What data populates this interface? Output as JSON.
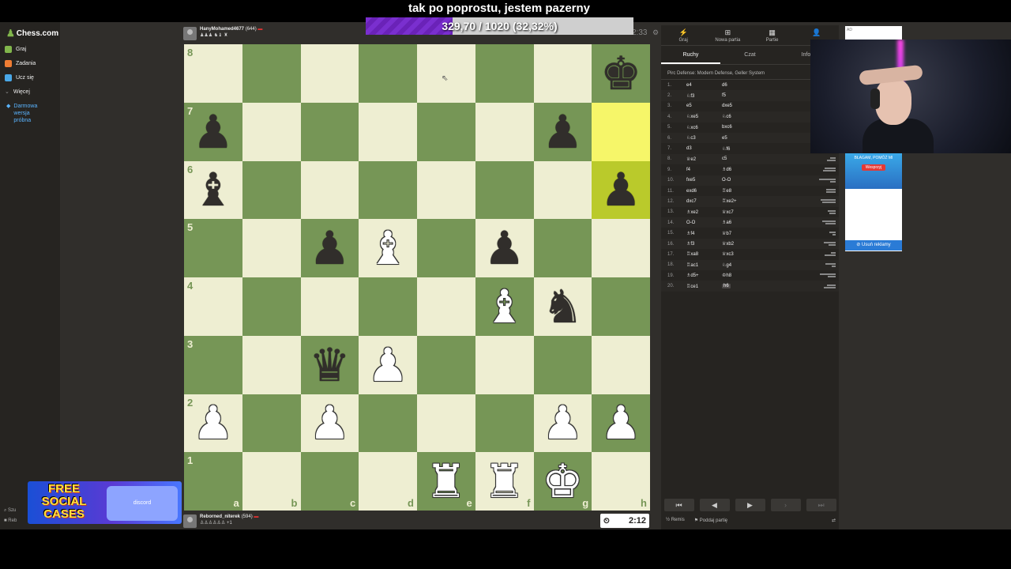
{
  "overlay": {
    "title": "tak po poprostu, jestem pazerny",
    "goal_text": "329,70 / 1020 (32,32%)",
    "goal_fraction": 0.3232
  },
  "sidebar": {
    "logo": "Chess.com",
    "items": [
      {
        "label": "Graj",
        "icon": "play-icon",
        "color": "#81b64c"
      },
      {
        "label": "Zadania",
        "icon": "puzzle-icon",
        "color": "#f07d33"
      },
      {
        "label": "Ucz się",
        "icon": "learn-icon",
        "color": "#4aa8e8"
      },
      {
        "label": "Więcej",
        "icon": "chevron-down-icon",
        "color": "#999"
      }
    ],
    "promo": "Darmowa wersja próbna",
    "bottom": [
      "Szu",
      "Reb"
    ]
  },
  "ad_overlay": {
    "text": "FREE SOCIAL CASES",
    "brand": "discord"
  },
  "players": {
    "top": {
      "name": "HanyMohamed4677",
      "rating": "(644)",
      "time": "2:33"
    },
    "bottom": {
      "name": "Reborned_niterek",
      "rating": "(594)",
      "time": "2:12"
    }
  },
  "board": {
    "files": [
      "a",
      "b",
      "c",
      "d",
      "e",
      "f",
      "g",
      "h"
    ],
    "ranks": [
      "8",
      "7",
      "6",
      "5",
      "4",
      "3",
      "2",
      "1"
    ],
    "highlight": [
      "h7",
      "h6"
    ],
    "pieces": {
      "h8": "bK",
      "a7": "bP",
      "g7": "bP",
      "a6": "bB",
      "h6": "bP",
      "c5": "bP",
      "d5": "wB",
      "f5": "bP",
      "f4": "wB",
      "g4": "bN",
      "c3": "bQ",
      "d3": "wP",
      "a2": "wP",
      "c2": "wP",
      "g2": "wP",
      "h2": "wP",
      "e1": "wR",
      "f1": "wR",
      "g1": "wK"
    }
  },
  "right_panel": {
    "top_tabs": [
      {
        "label": "Graj",
        "icon": "lightning-icon"
      },
      {
        "label": "Nowa partia",
        "icon": "plus-icon"
      },
      {
        "label": "Partie",
        "icon": "grid-icon"
      },
      {
        "label": "",
        "icon": "people-icon"
      }
    ],
    "tabs": [
      "Ruchy",
      "Czat",
      "Inform"
    ],
    "opening": "Pirc Defense: Modern Defense, Geller System",
    "moves": [
      {
        "n": "1.",
        "w": "e4",
        "b": "d6"
      },
      {
        "n": "2.",
        "w": "♘f3",
        "b": "f5"
      },
      {
        "n": "3.",
        "w": "e5",
        "b": "dxe5"
      },
      {
        "n": "4.",
        "w": "♘xe5",
        "b": "♘c6"
      },
      {
        "n": "5.",
        "w": "♘xc6",
        "b": "bxc6"
      },
      {
        "n": "6.",
        "w": "♘c3",
        "b": "e5"
      },
      {
        "n": "7.",
        "w": "d3",
        "b": "♘f6"
      },
      {
        "n": "8.",
        "w": "♕e2",
        "b": "c5"
      },
      {
        "n": "9.",
        "w": "f4",
        "b": "♗d6"
      },
      {
        "n": "10.",
        "w": "fxe5",
        "b": "O-O"
      },
      {
        "n": "11.",
        "w": "exd6",
        "b": "♖e8"
      },
      {
        "n": "12.",
        "w": "dxc7",
        "b": "♖xe2+"
      },
      {
        "n": "13.",
        "w": "♗xe2",
        "b": "♕xc7"
      },
      {
        "n": "14.",
        "w": "O-O",
        "b": "♗a6"
      },
      {
        "n": "15.",
        "w": "♗f4",
        "b": "♕b7"
      },
      {
        "n": "16.",
        "w": "♗f3",
        "b": "♕xb2"
      },
      {
        "n": "17.",
        "w": "♖xa8",
        "b": "♕xc3"
      },
      {
        "n": "18.",
        "w": "♖ac1",
        "b": "♘g4"
      },
      {
        "n": "19.",
        "w": "♗d5+",
        "b": "♔h8"
      },
      {
        "n": "20.",
        "w": "♖ce1",
        "b": "h6"
      }
    ],
    "nav": [
      "⏮",
      "◀",
      "▶",
      "›",
      "⏭"
    ],
    "draw_label": "Remis",
    "resign_label": "Poddaj partię"
  },
  "ads": {
    "label": "AD",
    "text": "BŁAGAM, POMÓŻ MI",
    "button": "Wesprzyj",
    "remove": "Usuń reklamy"
  }
}
